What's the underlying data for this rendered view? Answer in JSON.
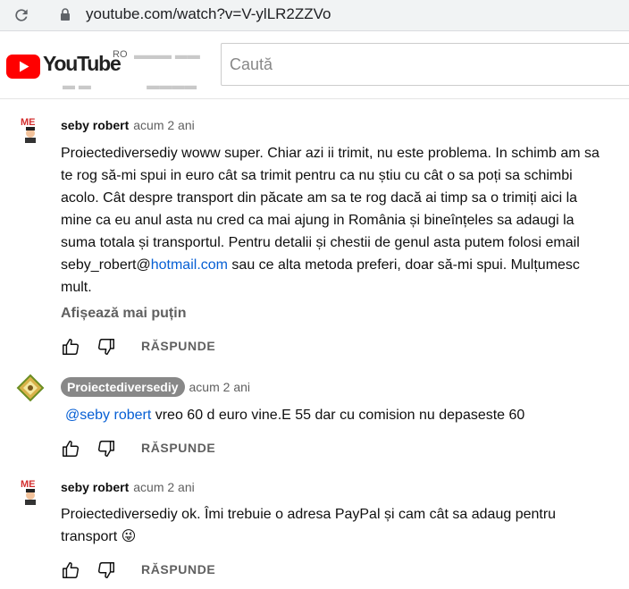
{
  "browser": {
    "url": "youtube.com/watch?v=V-ylLR2ZZVo"
  },
  "header": {
    "logo_text": "YouTube",
    "country_code": "RO",
    "search_placeholder": "Caută"
  },
  "comments": [
    {
      "author": "seby robert",
      "time": "acum 2 ani",
      "body_before_link": "Proiectediversediy woww super. Chiar azi ii trimit, nu este problema. In schimb am sa te rog să-mi spui in euro cât sa trimit pentru ca nu știu cu cât o sa poți sa schimbi acolo. Cât despre transport din păcate am sa te rog dacă ai timp sa o trimiți aici la mine ca eu anul asta nu cred ca mai ajung in România și bineînțeles sa adaugi la suma totala și transportul. Pentru detalii și chestii de genul asta putem folosi email seby_robert@",
      "link": "hotmail.com",
      "body_after_link": " sau ce alta metoda preferi, doar să-mi spui. Mulțumesc mult.",
      "show_less": "Afișează mai puțin",
      "reply_label": "RĂSPUNDE"
    },
    {
      "author": "Proiectediversediy",
      "time": "acum 2 ani",
      "mention": "@seby robert",
      "body": " vreo 60 d euro vine.E 55 dar cu comision nu depaseste 60",
      "reply_label": "RĂSPUNDE"
    },
    {
      "author": "seby robert",
      "time": "acum 2 ani",
      "body": "Proiectediversediy  ok. Îmi trebuie o adresa PayPal și cam cât sa adaug pentru transport ",
      "emoji": "😜",
      "reply_label": "RĂSPUNDE"
    }
  ],
  "colors": {
    "brand_red": "#ff0000",
    "link_blue": "#065fd4",
    "secondary_text": "#606060",
    "owner_chip": "#888888"
  },
  "icons": [
    "reload-icon",
    "lock-icon",
    "youtube-logo-icon",
    "avatar-me",
    "avatar-diamond",
    "thumbs-up-icon",
    "thumbs-down-icon",
    "tongue-out-emoji"
  ]
}
